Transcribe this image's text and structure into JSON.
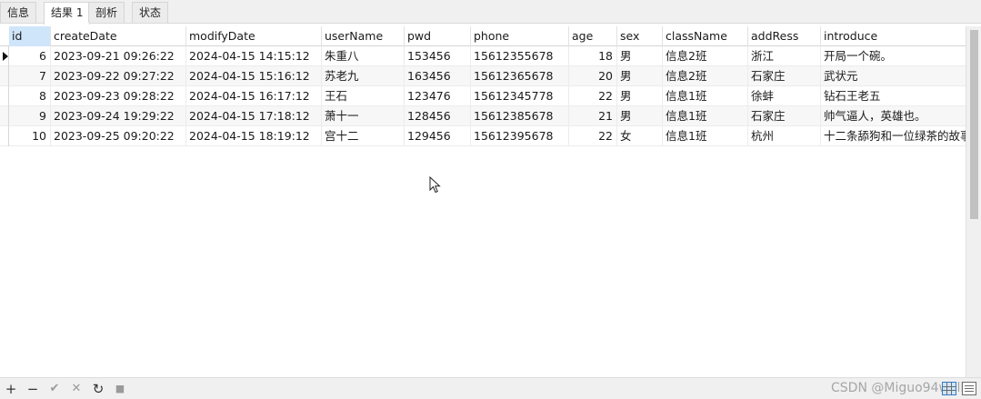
{
  "tabs": [
    {
      "label": "信息"
    },
    {
      "label": "结果 1"
    },
    {
      "label": "剖析"
    },
    {
      "label": "状态"
    }
  ],
  "table": {
    "columns": [
      "id",
      "createDate",
      "modifyDate",
      "userName",
      "pwd",
      "phone",
      "age",
      "sex",
      "className",
      "addRess",
      "introduce"
    ],
    "rows": [
      [
        "6",
        "2023-09-21 09:26:22",
        "2024-04-15 14:15:12",
        "朱重八",
        "153456",
        "15612355678",
        "18",
        "男",
        "信息2班",
        "浙江",
        "开局一个碗。"
      ],
      [
        "7",
        "2023-09-22 09:27:22",
        "2024-04-15 15:16:12",
        "苏老九",
        "163456",
        "15612365678",
        "20",
        "男",
        "信息2班",
        "石家庄",
        "武状元"
      ],
      [
        "8",
        "2023-09-23 09:28:22",
        "2024-04-15 16:17:12",
        "王石",
        "123476",
        "15612345778",
        "22",
        "男",
        "信息1班",
        "徐蚌",
        "钻石王老五"
      ],
      [
        "9",
        "2023-09-24 19:29:22",
        "2024-04-15 17:18:12",
        "萧十一",
        "128456",
        "15612385678",
        "21",
        "男",
        "信息1班",
        "石家庄",
        "帅气逼人，英雄也。"
      ],
      [
        "10",
        "2023-09-25 09:20:22",
        "2024-04-15 18:19:12",
        "宫十二",
        "129456",
        "15612395678",
        "22",
        "女",
        "信息1班",
        "杭州",
        "十二条舔狗和一位绿茶的故事"
      ]
    ]
  },
  "toolbar": {
    "add": "+",
    "remove": "−",
    "apply": "✔",
    "discard": "✕",
    "refresh": "↻",
    "stop": "■"
  },
  "watermark": "CSDN @Miguo94well",
  "colors": {
    "header_selected": "#cfe5fa",
    "row_alt": "#f7f7f7",
    "chrome": "#f0f0f0"
  }
}
